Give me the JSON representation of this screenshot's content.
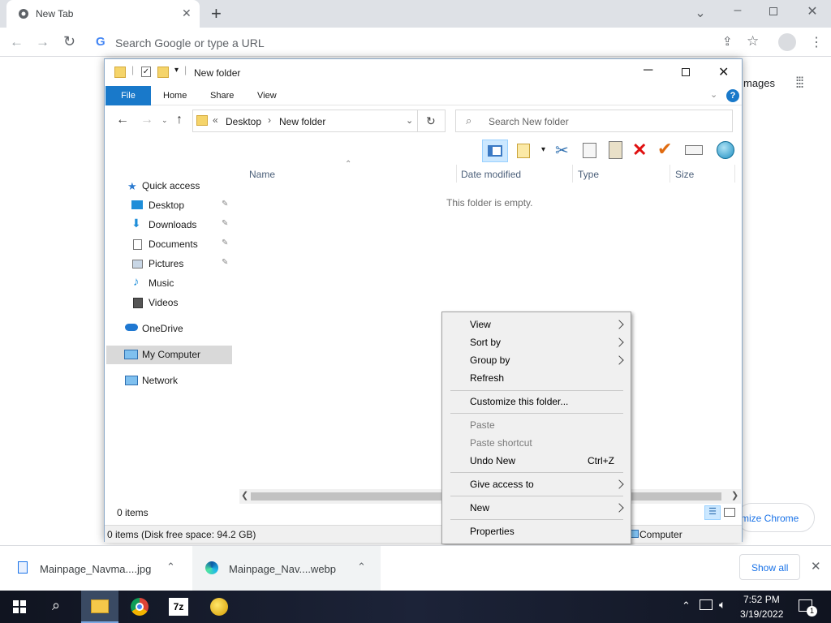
{
  "chrome": {
    "tab_title": "New Tab",
    "new_tab": "+",
    "omnibox_placeholder": "Search Google or type a URL",
    "images_link": "mages",
    "customize_link": "mize Chrome"
  },
  "explorer": {
    "title": "New folder",
    "ribbon_tabs": [
      "File",
      "Home",
      "Share",
      "View"
    ],
    "breadcrumb": {
      "prefix": "«",
      "items": [
        "Desktop",
        "New folder"
      ]
    },
    "search_placeholder": "Search New folder",
    "columns": [
      "Name",
      "Date modified",
      "Type",
      "Size"
    ],
    "empty_message": "This folder is empty.",
    "nav": {
      "quick_access": "Quick access",
      "quick_items": [
        "Desktop",
        "Downloads",
        "Documents",
        "Pictures",
        "Music",
        "Videos"
      ],
      "onedrive": "OneDrive",
      "my_computer": "My Computer",
      "network": "Network"
    },
    "items_count": "0 items",
    "status": "0 items (Disk free space: 94.2 GB)",
    "status_right": "Computer"
  },
  "context_menu": {
    "view": "View",
    "sort_by": "Sort by",
    "group_by": "Group by",
    "refresh": "Refresh",
    "customize": "Customize this folder...",
    "paste": "Paste",
    "paste_shortcut": "Paste shortcut",
    "undo_new": "Undo New",
    "undo_shortcut": "Ctrl+Z",
    "give_access": "Give access to",
    "new": "New",
    "properties": "Properties"
  },
  "downloads": {
    "item1": "Mainpage_Navma....jpg",
    "item2": "Mainpage_Nav....webp",
    "show_all": "Show all"
  },
  "taskbar": {
    "time": "7:52 PM",
    "date": "3/19/2022",
    "notif_count": "1",
    "app_7z": "7z"
  },
  "colors": {
    "accent": "#1979ca",
    "selection": "#cce8ff",
    "taskbar": "#101420"
  }
}
